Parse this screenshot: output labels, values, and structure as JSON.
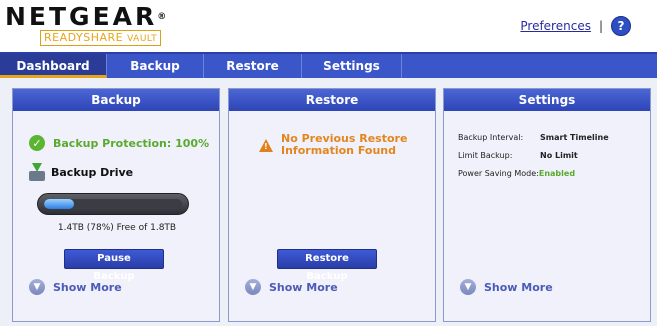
{
  "header": {
    "logo_main": "NETGEAR",
    "logo_reg": "®",
    "logo_sub_ready": "READYSHARE",
    "logo_sub_vault": "VAULT",
    "preferences_label": "Preferences",
    "separator": "|",
    "help_symbol": "?"
  },
  "tabs": [
    {
      "label": "Dashboard",
      "active": true
    },
    {
      "label": "Backup",
      "active": false
    },
    {
      "label": "Restore",
      "active": false
    },
    {
      "label": "Settings",
      "active": false
    }
  ],
  "backup_panel": {
    "title": "Backup",
    "protection_text": "Backup Protection: 100%",
    "drive_label": "Backup Drive",
    "capacity_text": "1.4TB (78%) Free of 1.8TB",
    "used_fraction": 0.22,
    "button_label": "Pause Backup",
    "show_more_label": "Show More"
  },
  "restore_panel": {
    "title": "Restore",
    "warning_line1": "No Previous Restore",
    "warning_line2": "Information Found",
    "button_label": "Restore Backup",
    "show_more_label": "Show More"
  },
  "settings_panel": {
    "title": "Settings",
    "rows": [
      {
        "label": "Backup Interval:",
        "value": "Smart Timeline"
      },
      {
        "label": "Limit Backup:",
        "value": "No Limit"
      },
      {
        "label": "Power Saving Mode:",
        "value": "Enabled"
      }
    ],
    "show_more_label": "Show More"
  },
  "icons": {
    "check": "check-icon",
    "drive": "backup-drive-icon",
    "warning": "warning-icon",
    "chevron": "chevron-down-icon",
    "help": "help-icon"
  },
  "colors": {
    "brand_blue": "#3a56c8",
    "accent_gold": "#e6a51a",
    "success_green": "#5aaa2e",
    "warning_orange": "#e3861e"
  }
}
